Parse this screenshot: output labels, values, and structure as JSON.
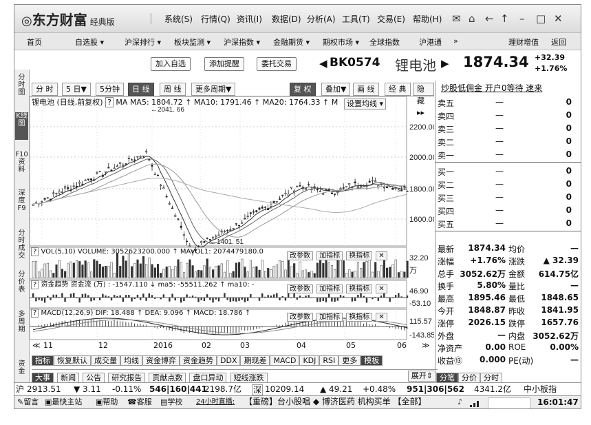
{
  "title_bar": {
    "logo": "东方财富",
    "edition": "经典版",
    "menu": [
      "系统(S)",
      "行情(Q)",
      "资讯(I)",
      "数据(D)",
      "分析(A)",
      "工具(T)",
      "交易(E)",
      "帮助(H)"
    ]
  },
  "nav": {
    "items": [
      "首页",
      "自选股 ▾",
      "沪深排行 ▾",
      "板块监测 ▾",
      "沪深指数 ▾",
      "金融期货 ▾",
      "期权市场 ▾",
      "全球指数",
      "沪港通",
      "»"
    ],
    "right": [
      "理财增值",
      "返回"
    ]
  },
  "sidebar": [
    "分时图",
    "K线图",
    "F10资料",
    "深度F9",
    "分时成交",
    "分价表",
    "多周期",
    "资金"
  ],
  "header": {
    "buttons": [
      "加入自选",
      "添加提醒",
      "委托交易"
    ],
    "code": "BK0574",
    "name": "锂电池",
    "price": "1874.34",
    "change": "+32.39",
    "change_pct": "+1.76%"
  },
  "chart_toolbar": {
    "left": [
      "分 时",
      "5 日▼",
      "5分钟",
      "日 线",
      "周 线",
      "更多周期▼"
    ],
    "right": [
      "复 权",
      "叠加▼",
      "画 线",
      "经 典",
      "隐藏▸▸"
    ],
    "active": "日 线"
  },
  "kline_info": {
    "label": "锂电池 (日线,前复权)",
    "ma5": "MA5: 1804.72 ↑",
    "ma10": "MA10: 1791.46 ↑",
    "ma20": "MA20: 1764.33 ↑",
    "ma_trunc": "M",
    "set_btn": "设置均线 ▾",
    "high_label": "2041. 66",
    "low_label": "1401. 51",
    "y_ticks": [
      "2200.00",
      "2000.00",
      "1800.00",
      "1600.00"
    ]
  },
  "vol_panel": {
    "info": "VOL(5,10)  VOLUME: 3052623200.000 ↑  MAVOL1: 2074479180.0",
    "y_ticks": [
      "32.20",
      "万"
    ]
  },
  "fund_panel": {
    "info": "资金趋势  资金流 (万)  : -1547.110 ↓  ma5: -55511.262 ↑  ma10: -",
    "y_ticks": [
      "46.90",
      "-53.10"
    ]
  },
  "macd_panel": {
    "info": "MACD(12,26,9)  DIF: 18.488 ↑  DEA: 9.096 ↑  MACD: 18.786 ↑",
    "y_ticks": [
      "115.57",
      "-143.85"
    ]
  },
  "panel_buttons": [
    "改参数",
    "加指标",
    "换指标",
    "✕"
  ],
  "x_axis": [
    "11",
    "12",
    "2016",
    "02",
    "03",
    "04",
    "05",
    "06"
  ],
  "indicator_tabs": [
    "指标",
    "恢复默认",
    "成交量",
    "均线",
    "资金博弈",
    "资金趋势",
    "DDX",
    "期现差",
    "MACD",
    "KDJ",
    "RSI",
    "更多",
    "模板"
  ],
  "news_tabs": [
    "大事",
    "新闻",
    "公告",
    "研究报告",
    "贡献点数",
    "盘口异动",
    "短线涨跌"
  ],
  "news_expand": "展开⇕",
  "right_panel": {
    "top_link": "炒股低佣金 开户0等待 速来",
    "sell": [
      {
        "l": "卖五",
        "p": "—",
        "v": "0"
      },
      {
        "l": "卖四",
        "p": "—",
        "v": "0"
      },
      {
        "l": "卖三",
        "p": "—",
        "v": "0"
      },
      {
        "l": "卖二",
        "p": "—",
        "v": "0"
      },
      {
        "l": "卖一",
        "p": "—",
        "v": "0"
      }
    ],
    "buy": [
      {
        "l": "买一",
        "p": "—",
        "v": "0"
      },
      {
        "l": "买二",
        "p": "—",
        "v": "0"
      },
      {
        "l": "买三",
        "p": "—",
        "v": "0"
      },
      {
        "l": "买四",
        "p": "—",
        "v": "0"
      },
      {
        "l": "买五",
        "p": "—",
        "v": "0"
      }
    ],
    "quotes": [
      [
        "最新",
        "1874.34",
        "均价",
        "—"
      ],
      [
        "涨幅",
        "+1.76%",
        "涨跌",
        "▲ 32.39"
      ],
      [
        "总手",
        "3052.62万",
        "金额",
        "614.75亿"
      ],
      [
        "换手",
        "5.80%",
        "量比",
        "—"
      ],
      [
        "最高",
        "1895.46",
        "最低",
        "1848.65"
      ],
      [
        "今开",
        "1848.87",
        "昨收",
        "1841.95"
      ],
      [
        "涨停",
        "2026.15",
        "跌停",
        "1657.76"
      ],
      [
        "外盘",
        "—",
        "内盘",
        "3052.62万"
      ],
      [
        "净资产",
        "0.00",
        "ROE",
        "0.00%"
      ],
      [
        "收益⑬",
        "0.000",
        "PE(动)",
        "—"
      ]
    ],
    "bottom_tabs": [
      "分笔",
      "分价",
      "分时"
    ]
  },
  "status_bar": {
    "sh_label": "沪",
    "sh_index": "2913.51",
    "sh_change": "▼ 3.11",
    "sh_pct": "-0.11%",
    "sh_breadth": "546|160|441",
    "sh_amount": "2198.7亿",
    "sz_label": "深",
    "sz_index": "10209.14",
    "sz_change": "▲ 49.21",
    "sz_pct": "+0.48%",
    "sz_breadth": "951|306|562",
    "sz_amount": "4341.2亿",
    "board": "中小板指"
  },
  "bottom_bar": {
    "items": [
      "留言",
      "最快主站",
      "帮助",
      "客服",
      "学校"
    ],
    "live": "24小时直播:",
    "ticker": "【重磅】台小股唱 ◆ 博济医药 机构买单 【全部】",
    "time": "16:01:47"
  }
}
